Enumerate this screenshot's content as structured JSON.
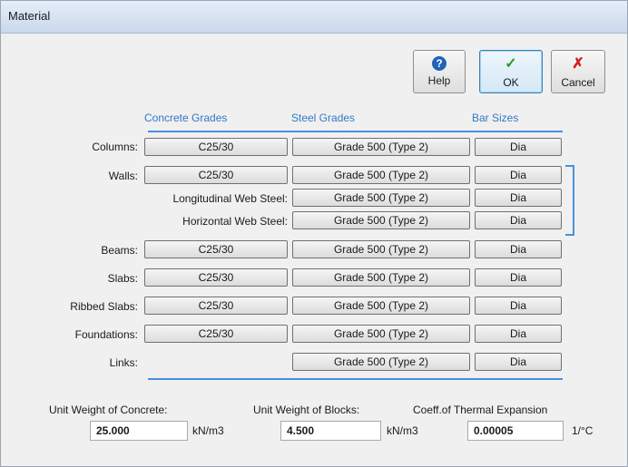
{
  "window": {
    "title": "Material"
  },
  "toolbar": {
    "help_label": "Help",
    "ok_label": "OK",
    "cancel_label": "Cancel",
    "help_icon": "?",
    "ok_icon": "✓",
    "cancel_icon": "✗"
  },
  "headers": {
    "concrete": "Concrete Grades",
    "steel": "Steel Grades",
    "bars": "Bar Sizes"
  },
  "rows": {
    "columns": {
      "label": "Columns:",
      "concrete": "C25/30",
      "steel": "Grade 500 (Type 2)",
      "bar": "Dia"
    },
    "walls": {
      "label": "Walls:",
      "concrete": "C25/30",
      "steel": "Grade 500 (Type 2)",
      "bar": "Dia"
    },
    "long_web": {
      "label": "Longitudinal Web Steel:",
      "steel": "Grade 500 (Type 2)",
      "bar": "Dia"
    },
    "horiz_web": {
      "label": "Horizontal Web Steel:",
      "steel": "Grade 500 (Type 2)",
      "bar": "Dia"
    },
    "beams": {
      "label": "Beams:",
      "concrete": "C25/30",
      "steel": "Grade 500 (Type 2)",
      "bar": "Dia"
    },
    "slabs": {
      "label": "Slabs:",
      "concrete": "C25/30",
      "steel": "Grade 500 (Type 2)",
      "bar": "Dia"
    },
    "ribbed": {
      "label": "Ribbed Slabs:",
      "concrete": "C25/30",
      "steel": "Grade 500 (Type 2)",
      "bar": "Dia"
    },
    "found": {
      "label": "Foundations:",
      "concrete": "C25/30",
      "steel": "Grade 500 (Type 2)",
      "bar": "Dia"
    },
    "links": {
      "label": "Links:",
      "steel": "Grade 500 (Type 2)",
      "bar": "Dia"
    }
  },
  "properties": {
    "concrete_weight_label": "Unit Weight of Concrete:",
    "concrete_weight_value": "25.000",
    "concrete_weight_unit": "kN/m3",
    "blocks_weight_label": "Unit Weight of Blocks:",
    "blocks_weight_value": "4.500",
    "blocks_weight_unit": "kN/m3",
    "thermal_label": "Coeff.of Thermal Expansion",
    "thermal_value": "0.00005",
    "thermal_unit": "1/°C"
  },
  "colors": {
    "accent": "#4a90dc",
    "header_text": "#3278c8"
  }
}
